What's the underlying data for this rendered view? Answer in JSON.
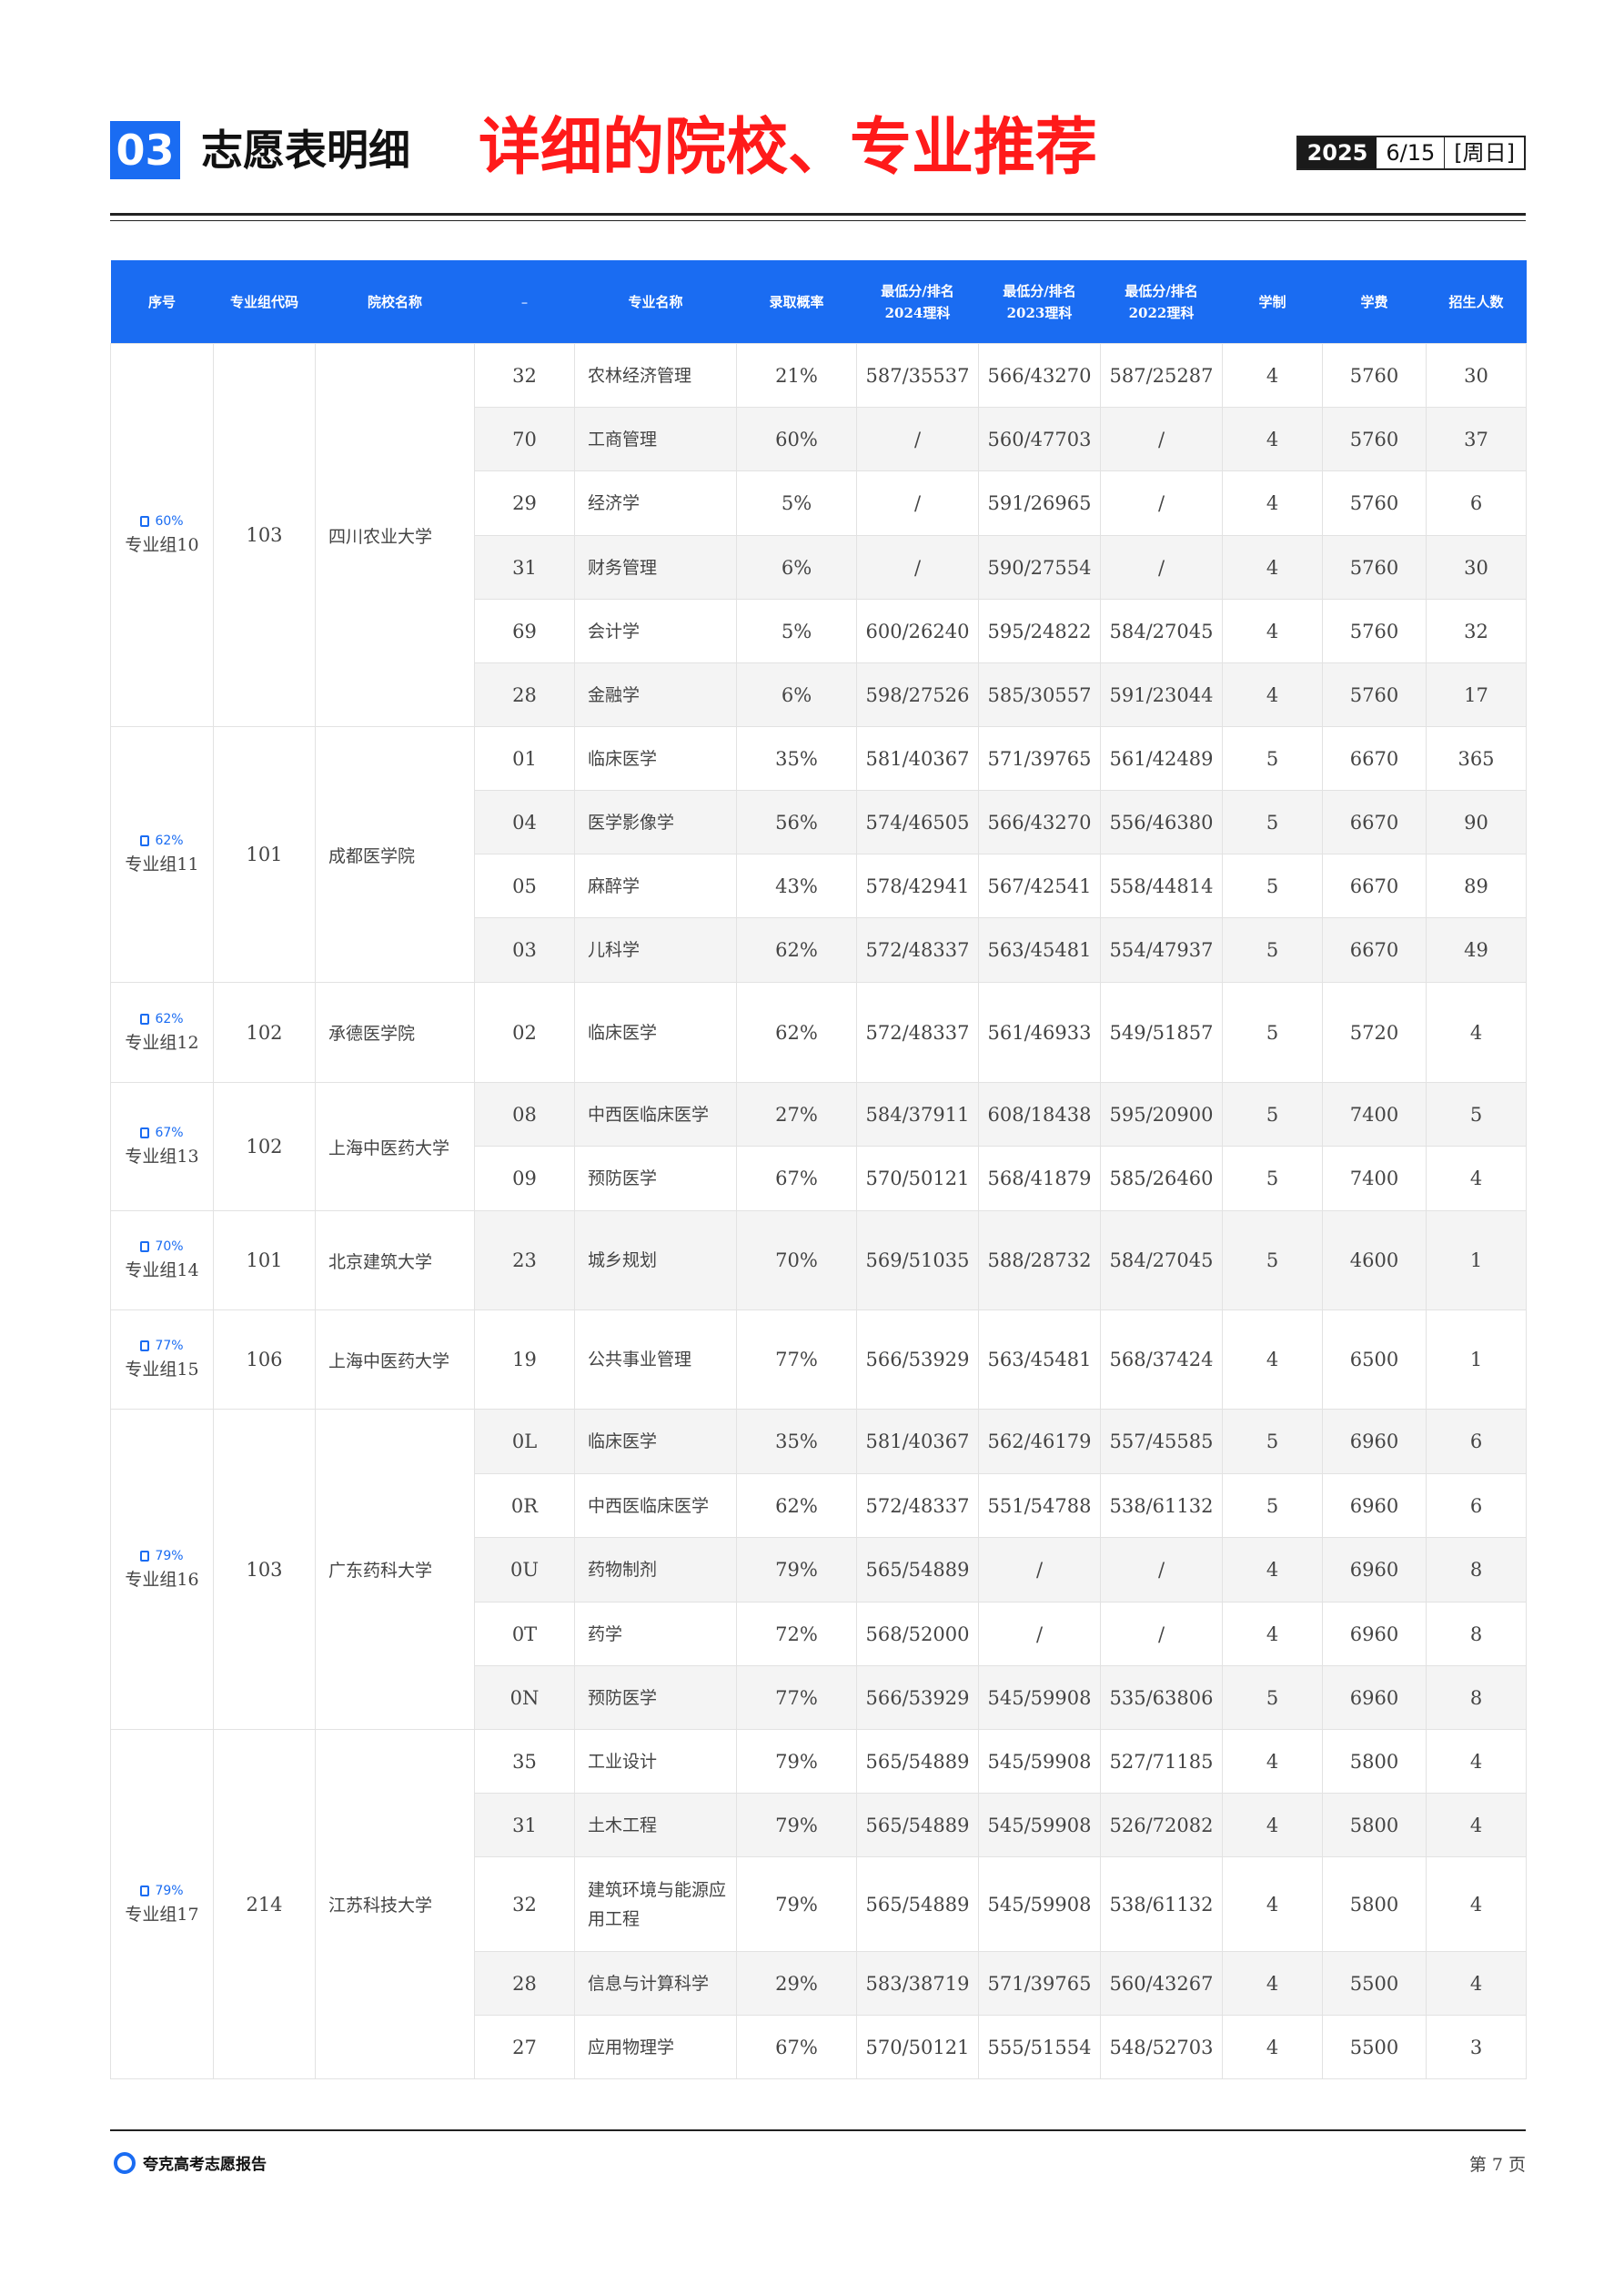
{
  "header": {
    "section_number": "03",
    "section_title": "志愿表明细",
    "overlay_text": "详细的院校、专业推荐",
    "date_year": "2025",
    "date_md": "6/15",
    "date_weekday": "[周日]"
  },
  "table": {
    "columns": [
      "序号",
      "专业组代码",
      "院校名称",
      "–",
      "专业名称",
      "录取概率",
      "最低分/排名\n2024理科",
      "最低分/排名\n2023理科",
      "最低分/排名\n2022理科",
      "学制",
      "学费",
      "招生人数"
    ],
    "groups": [
      {
        "badge": "60%",
        "group_name": "专业组10",
        "group_code": "103",
        "school": "四川农业大学",
        "rows": [
          {
            "code": "32",
            "major": "农林经济管理",
            "prob": "21%",
            "y2024": "587/35537",
            "y2023": "566/43270",
            "y2022": "587/25287",
            "years": "4",
            "fee": "5760",
            "count": "30"
          },
          {
            "code": "70",
            "major": "工商管理",
            "prob": "60%",
            "y2024": "/",
            "y2023": "560/47703",
            "y2022": "/",
            "years": "4",
            "fee": "5760",
            "count": "37"
          },
          {
            "code": "29",
            "major": "经济学",
            "prob": "5%",
            "y2024": "/",
            "y2023": "591/26965",
            "y2022": "/",
            "years": "4",
            "fee": "5760",
            "count": "6"
          },
          {
            "code": "31",
            "major": "财务管理",
            "prob": "6%",
            "y2024": "/",
            "y2023": "590/27554",
            "y2022": "/",
            "years": "4",
            "fee": "5760",
            "count": "30"
          },
          {
            "code": "69",
            "major": "会计学",
            "prob": "5%",
            "y2024": "600/26240",
            "y2023": "595/24822",
            "y2022": "584/27045",
            "years": "4",
            "fee": "5760",
            "count": "32"
          },
          {
            "code": "28",
            "major": "金融学",
            "prob": "6%",
            "y2024": "598/27526",
            "y2023": "585/30557",
            "y2022": "591/23044",
            "years": "4",
            "fee": "5760",
            "count": "17"
          }
        ]
      },
      {
        "badge": "62%",
        "group_name": "专业组11",
        "group_code": "101",
        "school": "成都医学院",
        "rows": [
          {
            "code": "01",
            "major": "临床医学",
            "prob": "35%",
            "y2024": "581/40367",
            "y2023": "571/39765",
            "y2022": "561/42489",
            "years": "5",
            "fee": "6670",
            "count": "365"
          },
          {
            "code": "04",
            "major": "医学影像学",
            "prob": "56%",
            "y2024": "574/46505",
            "y2023": "566/43270",
            "y2022": "556/46380",
            "years": "5",
            "fee": "6670",
            "count": "90"
          },
          {
            "code": "05",
            "major": "麻醉学",
            "prob": "43%",
            "y2024": "578/42941",
            "y2023": "567/42541",
            "y2022": "558/44814",
            "years": "5",
            "fee": "6670",
            "count": "89"
          },
          {
            "code": "03",
            "major": "儿科学",
            "prob": "62%",
            "y2024": "572/48337",
            "y2023": "563/45481",
            "y2022": "554/47937",
            "years": "5",
            "fee": "6670",
            "count": "49"
          }
        ]
      },
      {
        "badge": "62%",
        "group_name": "专业组12",
        "group_code": "102",
        "school": "承德医学院",
        "rows": [
          {
            "code": "02",
            "major": "临床医学",
            "prob": "62%",
            "y2024": "572/48337",
            "y2023": "561/46933",
            "y2022": "549/51857",
            "years": "5",
            "fee": "5720",
            "count": "4"
          }
        ]
      },
      {
        "badge": "67%",
        "group_name": "专业组13",
        "group_code": "102",
        "school": "上海中医药大学",
        "rows": [
          {
            "code": "08",
            "major": "中西医临床医学",
            "prob": "27%",
            "y2024": "584/37911",
            "y2023": "608/18438",
            "y2022": "595/20900",
            "years": "5",
            "fee": "7400",
            "count": "5"
          },
          {
            "code": "09",
            "major": "预防医学",
            "prob": "67%",
            "y2024": "570/50121",
            "y2023": "568/41879",
            "y2022": "585/26460",
            "years": "5",
            "fee": "7400",
            "count": "4"
          }
        ]
      },
      {
        "badge": "70%",
        "group_name": "专业组14",
        "group_code": "101",
        "school": "北京建筑大学",
        "rows": [
          {
            "code": "23",
            "major": "城乡规划",
            "prob": "70%",
            "y2024": "569/51035",
            "y2023": "588/28732",
            "y2022": "584/27045",
            "years": "5",
            "fee": "4600",
            "count": "1"
          }
        ]
      },
      {
        "badge": "77%",
        "group_name": "专业组15",
        "group_code": "106",
        "school": "上海中医药大学",
        "rows": [
          {
            "code": "19",
            "major": "公共事业管理",
            "prob": "77%",
            "y2024": "566/53929",
            "y2023": "563/45481",
            "y2022": "568/37424",
            "years": "4",
            "fee": "6500",
            "count": "1"
          }
        ]
      },
      {
        "badge": "79%",
        "group_name": "专业组16",
        "group_code": "103",
        "school": "广东药科大学",
        "rows": [
          {
            "code": "0L",
            "major": "临床医学",
            "prob": "35%",
            "y2024": "581/40367",
            "y2023": "562/46179",
            "y2022": "557/45585",
            "years": "5",
            "fee": "6960",
            "count": "6"
          },
          {
            "code": "0R",
            "major": "中西医临床医学",
            "prob": "62%",
            "y2024": "572/48337",
            "y2023": "551/54788",
            "y2022": "538/61132",
            "years": "5",
            "fee": "6960",
            "count": "6"
          },
          {
            "code": "0U",
            "major": "药物制剂",
            "prob": "79%",
            "y2024": "565/54889",
            "y2023": "/",
            "y2022": "/",
            "years": "4",
            "fee": "6960",
            "count": "8"
          },
          {
            "code": "0T",
            "major": "药学",
            "prob": "72%",
            "y2024": "568/52000",
            "y2023": "/",
            "y2022": "/",
            "years": "4",
            "fee": "6960",
            "count": "8"
          },
          {
            "code": "0N",
            "major": "预防医学",
            "prob": "77%",
            "y2024": "566/53929",
            "y2023": "545/59908",
            "y2022": "535/63806",
            "years": "5",
            "fee": "6960",
            "count": "8"
          }
        ]
      },
      {
        "badge": "79%",
        "group_name": "专业组17",
        "group_code": "214",
        "school": "江苏科技大学",
        "rows": [
          {
            "code": "35",
            "major": "工业设计",
            "prob": "79%",
            "y2024": "565/54889",
            "y2023": "545/59908",
            "y2022": "527/71185",
            "years": "4",
            "fee": "5800",
            "count": "4"
          },
          {
            "code": "31",
            "major": "土木工程",
            "prob": "79%",
            "y2024": "565/54889",
            "y2023": "545/59908",
            "y2022": "526/72082",
            "years": "4",
            "fee": "5800",
            "count": "4"
          },
          {
            "code": "32",
            "major": "建筑环境与能源应用工程",
            "prob": "79%",
            "y2024": "565/54889",
            "y2023": "545/59908",
            "y2022": "538/61132",
            "years": "4",
            "fee": "5800",
            "count": "4"
          },
          {
            "code": "28",
            "major": "信息与计算科学",
            "prob": "29%",
            "y2024": "583/38719",
            "y2023": "571/39765",
            "y2022": "560/43267",
            "years": "4",
            "fee": "5500",
            "count": "4"
          },
          {
            "code": "27",
            "major": "应用物理学",
            "prob": "67%",
            "y2024": "570/50121",
            "y2023": "555/51554",
            "y2022": "548/52703",
            "years": "4",
            "fee": "5500",
            "count": "3"
          }
        ]
      }
    ]
  },
  "footer": {
    "brand": "夸克高考志愿报告",
    "page_label": "第 7 页"
  },
  "colors": {
    "accent": "#1a6cf2",
    "overlay": "#ff1a1a",
    "alt_row": "#f4f4f4"
  }
}
